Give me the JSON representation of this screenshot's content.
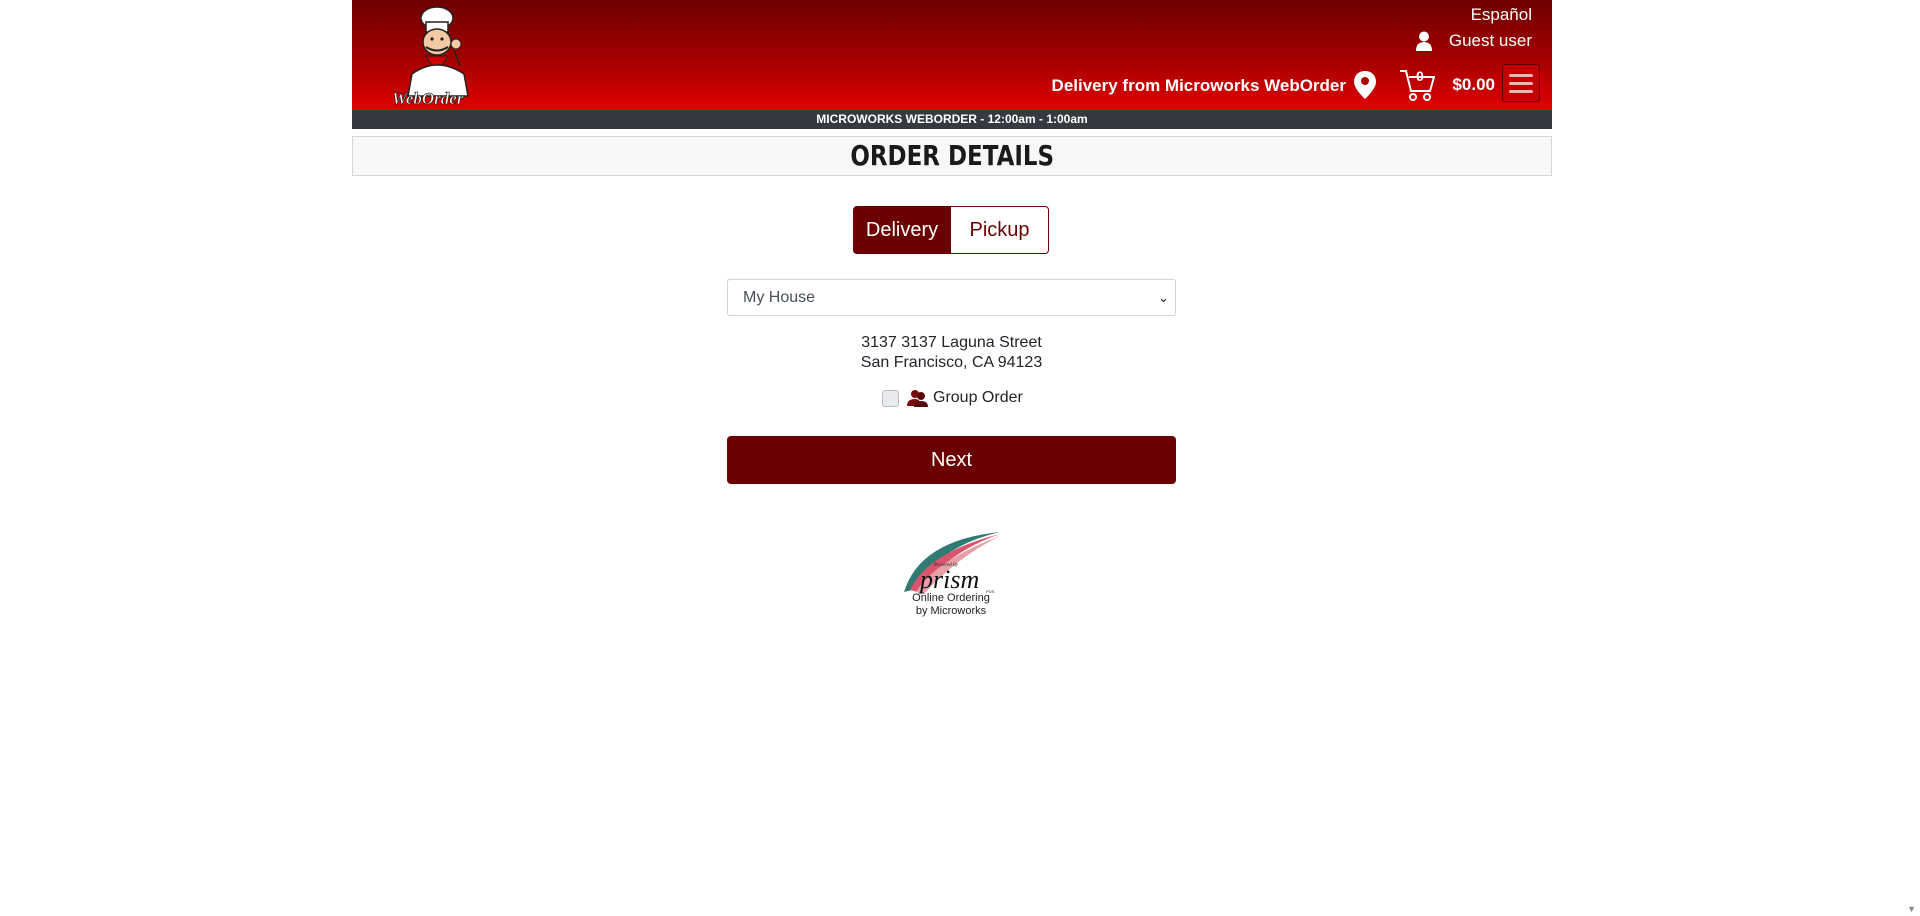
{
  "header": {
    "logo_text": "WebOrder",
    "language": "Español",
    "user": "Guest user",
    "delivery_from": "Delivery from Microworks WebOrder",
    "cart_count": "0",
    "cart_total": "$0.00",
    "icons": [
      "user-icon",
      "location-pin-icon",
      "cart-icon",
      "hamburger-menu-icon"
    ]
  },
  "hours_bar": "MICROWORKS WEBORDER - 12:00am - 1:00am",
  "page_title": "ORDER DETAILS",
  "order_type": {
    "options": [
      "Delivery",
      "Pickup"
    ],
    "selected": "Delivery"
  },
  "address_select": {
    "value": "My House"
  },
  "address": {
    "line1": "3137 3137 Laguna Street",
    "line2": "San Francisco, CA 94123"
  },
  "group_order": {
    "label": "Group Order",
    "checked": false
  },
  "next_button": "Next",
  "footer": {
    "brand_small": "Powered By",
    "brand": "prism",
    "brand_suffix": "POS",
    "line1": "Online Ordering",
    "line2": "by Microworks"
  },
  "colors": {
    "primary": "#6b0000",
    "header_red": "#d40000",
    "hours_bar": "#343a40"
  }
}
